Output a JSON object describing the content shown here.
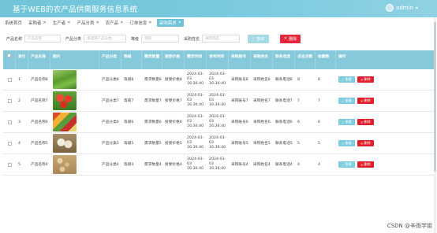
{
  "app": {
    "title": "基于WEB的农产品供需服务信息系统",
    "username": "admin"
  },
  "tabs": [
    {
      "label": "系统首页"
    },
    {
      "label": "采购者"
    },
    {
      "label": "生产者"
    },
    {
      "label": "产品分类"
    },
    {
      "label": "农产品"
    },
    {
      "label": "订单信息"
    },
    {
      "label": "采购需求"
    }
  ],
  "filters": {
    "f1_label": "产品名称",
    "f1_placeholder": "产品名称",
    "f2_label": "产品分类",
    "f2_placeholder": "请选择产品分类",
    "f3_label": "等级",
    "f3_placeholder": "等级",
    "f4_label": "采购姓名",
    "f4_placeholder": "采购姓名",
    "search_label": "查询",
    "delete_label": "删除"
  },
  "table": {
    "headers": [
      "索引",
      "产品名称",
      "图片",
      "产品分类",
      "等级",
      "需求数量",
      "接受价格",
      "需求时间",
      "发布时间",
      "采购账号",
      "采购姓名",
      "联系电话",
      "点击次数",
      "收藏数",
      "操作"
    ],
    "view_label": "查看",
    "delete_label": "删除",
    "rows": [
      {
        "index": "1",
        "name": "产品名称8",
        "img": "green",
        "category": "产品分类8",
        "grade": "等级8",
        "qty": "需求数量8",
        "price": "接受价格8",
        "need_time": "2024-03-03 16:36:40",
        "pub_time": "2024-03-03 16:36:40",
        "account": "采购账号8",
        "buyer": "采购姓名8",
        "phone": "联系电话8",
        "clicks": "8",
        "favs": "8"
      },
      {
        "index": "2",
        "name": "产品名称7",
        "img": "tomato",
        "category": "产品分类7",
        "grade": "等级7",
        "qty": "需求数量7",
        "price": "接受价格7",
        "need_time": "2024-03-03 16:36:40",
        "pub_time": "2024-03-03 16:36:40",
        "account": "采购账号7",
        "buyer": "采购姓名7",
        "phone": "联系电话7",
        "clicks": "7",
        "favs": "7"
      },
      {
        "index": "3",
        "name": "产品名称6",
        "img": "mixed",
        "category": "产品分类6",
        "grade": "等级6",
        "qty": "需求数量6",
        "price": "接受价格6",
        "need_time": "2024-03-03 16:36:40",
        "pub_time": "2024-03-03 16:36:40",
        "account": "采购账号6",
        "buyer": "采购姓名6",
        "phone": "联系电话6",
        "clicks": "6",
        "favs": "6"
      },
      {
        "index": "4",
        "name": "产品名称5",
        "img": "garlic",
        "category": "产品分类5",
        "grade": "等级5",
        "qty": "需求数量5",
        "price": "接受价格5",
        "need_time": "2024-03-03 16:36:40",
        "pub_time": "2024-03-03 16:36:40",
        "account": "采购账号5",
        "buyer": "采购姓名5",
        "phone": "联系电话5",
        "clicks": "5",
        "favs": "5"
      },
      {
        "index": "5",
        "name": "产品名称4",
        "img": "peanut",
        "category": "产品分类4",
        "grade": "等级4",
        "qty": "需求数量4",
        "price": "接受价格4",
        "need_time": "2024-03-03 16:36:40",
        "pub_time": "2024-03-03 16:36:40",
        "account": "采购账号4",
        "buyer": "采购姓名4",
        "phone": "联系电话4",
        "clicks": "4",
        "favs": "4"
      }
    ]
  },
  "watermark": "CSDN @辛雨学姐",
  "colors": {
    "header": "#85c9da",
    "topbar": "#71c4d8",
    "delete": "#e01f2c",
    "view": "#7fcde0"
  }
}
